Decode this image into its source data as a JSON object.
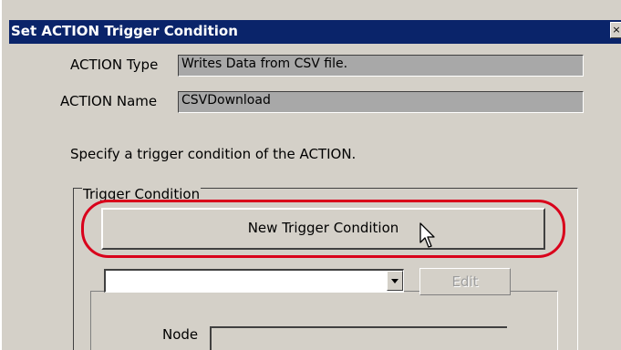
{
  "window": {
    "title": "Set ACTION Trigger Condition",
    "close_symbol": "×"
  },
  "fields": {
    "action_type_label": "ACTION Type",
    "action_type_value": "Writes Data from CSV file.",
    "action_name_label": "ACTION Name",
    "action_name_value": "CSVDownload"
  },
  "instruction": "Specify a trigger condition of the ACTION.",
  "trigger_group": {
    "label": "Trigger Condition",
    "new_button": "New Trigger Condition",
    "combo_value": "",
    "edit_button": "Edit",
    "node_label": "Node",
    "node_value": ""
  },
  "icons": {
    "close": "close-icon",
    "combo_arrow": "chevron-down-icon",
    "cursor": "mouse-pointer-icon"
  },
  "colors": {
    "titlebar": "#0a246a",
    "dialog_bg": "#d4d0c8",
    "readonly_field": "#a8a8a8",
    "highlight_ring": "#d9001b"
  }
}
